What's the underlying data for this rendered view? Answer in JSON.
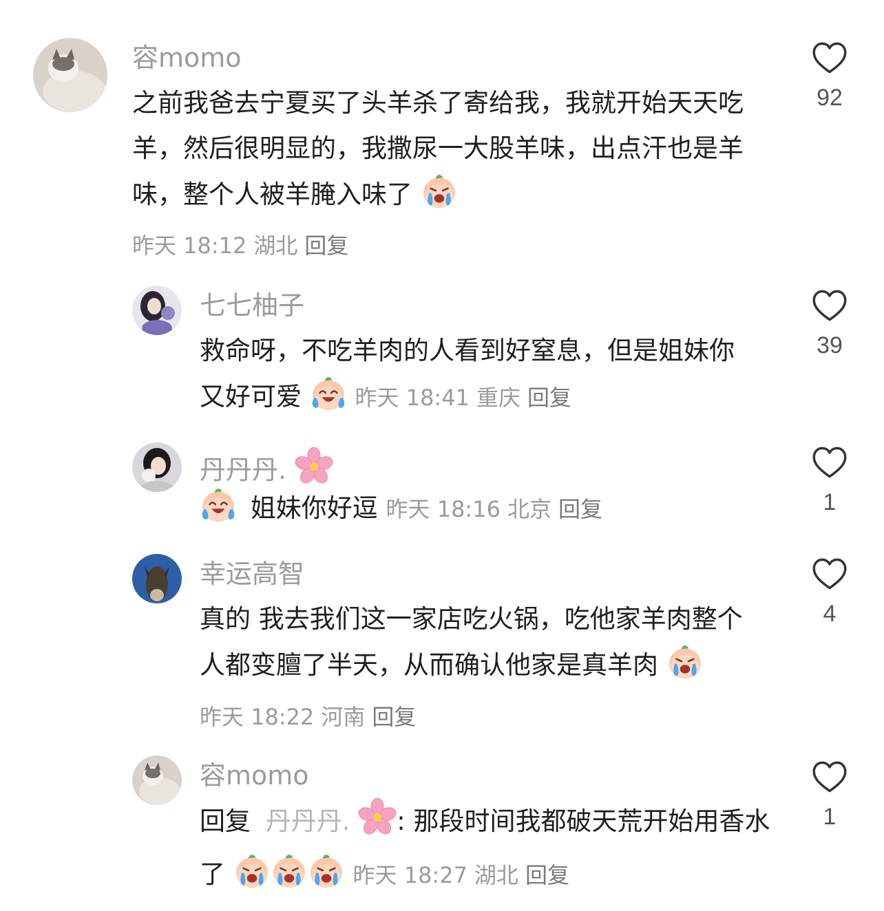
{
  "colors": {
    "username": "#9b9b9b",
    "text": "#1f1f1f",
    "meta": "#9b9b9b",
    "heart_stroke": "#333333"
  },
  "comments": [
    {
      "username": "容momo",
      "text": "之前我爸去宁夏买了头羊杀了寄给我，我就开始天天吃羊，然后很明显的，我撒尿一大股羊味，出点汗也是羊味，整个人被羊腌入味了",
      "emoji": "crying-face-emoji",
      "time": "昨天 18:12",
      "location": "湖北",
      "reply_label": "回复",
      "likes": "92"
    },
    {
      "username": "七七柚子",
      "text": "救命呀，不吃羊肉的人看到好窒息，但是姐妹你又好可爱",
      "emoji": "laugh-cry-face-emoji",
      "time": "昨天 18:41",
      "location": "重庆",
      "reply_label": "回复",
      "likes": "39"
    },
    {
      "username": "丹丹丹.",
      "name_icon": "cherry-blossom-icon",
      "text": "姐妹你好逗",
      "emoji": "laugh-cry-face-emoji",
      "time": "昨天 18:16",
      "location": "北京",
      "reply_label": "回复",
      "likes": "1"
    },
    {
      "username": "幸运高智",
      "text": "真的 我去我们这一家店吃火锅，吃他家羊肉整个人都变膻了半天，从而确认他家是真羊肉",
      "emoji": "crying-face-emoji",
      "time": "昨天 18:22",
      "location": "河南",
      "reply_label": "回复",
      "likes": "4"
    },
    {
      "username": "容momo",
      "reply_prefix": "回复",
      "reply_to": "丹丹丹.",
      "separator": ":",
      "text": "那段时间我都破天荒开始用香水了",
      "emoji": "crying-face-emoji",
      "time": "昨天 18:27",
      "location": "湖北",
      "reply_label": "回复",
      "likes": "1"
    }
  ]
}
